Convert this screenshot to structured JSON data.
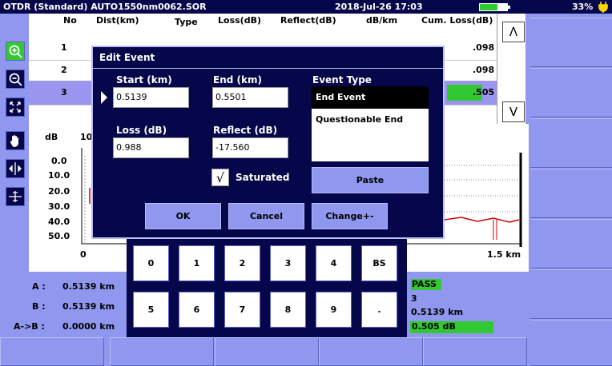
{
  "titlebar": {
    "title": "OTDR (Standard) AUTO1550nm0062.SOR",
    "datetime": "2018-Jul-26 17:03",
    "battery": "33%",
    "battery_level": 0.66
  },
  "table": {
    "headers": [
      "No",
      "Dist(km)",
      "Type",
      "Loss(dB)",
      "Reflect(dB)",
      "dB/km",
      "Cum. Loss(dB)"
    ],
    "rows": [
      {
        "no": "1",
        "cum": ".098"
      },
      {
        "no": "2",
        "cum": ".098"
      },
      {
        "no": "3",
        "cum": ".505"
      }
    ],
    "scroll_up": "Λ",
    "scroll_down": "V"
  },
  "graph": {
    "y_unit": "dB",
    "y_ticks": [
      "0.0",
      "10.0",
      "20.0",
      "30.0",
      "40.0",
      "50.0"
    ],
    "x_start": "0",
    "x_top_partial": "10",
    "x_end": "1.5 km"
  },
  "cursors": {
    "a_label": "A :",
    "a_value": "0.5139 km",
    "b_label": "B :",
    "b_value": "0.5139 km",
    "ab_label": "A->B :",
    "ab_value": "0.0000 km"
  },
  "result": {
    "status": "PASS",
    "count": "3",
    "length": "0.5139 km",
    "loss": "0.505 dB"
  },
  "dialog": {
    "title": "Edit Event",
    "start_label": "Start (km)",
    "start_value": "0.5139",
    "end_label": "End (km)",
    "end_value": "0.5501",
    "loss_label": "Loss (dB)",
    "loss_value": "0.988",
    "reflect_label": "Reflect (dB)",
    "reflect_value": "-17.560",
    "event_type_label": "Event Type",
    "event_types": [
      "End Event",
      "Questionable End"
    ],
    "saturated_label": "Saturated",
    "saturated_mark": "√",
    "paste": "Paste",
    "ok": "OK",
    "cancel": "Cancel",
    "change": "Change+-"
  },
  "numpad": {
    "keys": [
      "0",
      "1",
      "2",
      "3",
      "4",
      "BS",
      "5",
      "6",
      "7",
      "8",
      "9",
      "."
    ]
  },
  "colors": {
    "navy": "#06064a",
    "panel": "#8f97ee",
    "highlight": "#32c832",
    "selected_row": "#9a96f0"
  }
}
